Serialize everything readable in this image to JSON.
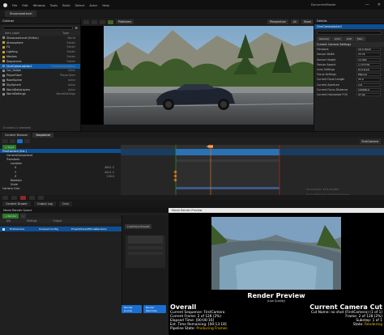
{
  "menu": [
    "File",
    "Edit",
    "Window",
    "Tools",
    "Build",
    "Select",
    "Actor",
    "Help"
  ],
  "doc_tab": "ShowcaseLevel",
  "user": "DocumentMaster",
  "outliner": {
    "title": "Outliner",
    "col_label": "Item Label",
    "col_type": "Type",
    "rows": [
      {
        "label": "ShowcaseLevel (Editor)",
        "type": "World",
        "sel": false
      },
      {
        "label": "Atmosphere",
        "type": "Folder",
        "sel": false
      },
      {
        "label": "FX",
        "type": "Folder",
        "sel": false
      },
      {
        "label": "Lighting",
        "type": "Folder",
        "sel": false
      },
      {
        "label": "Meshes",
        "type": "Folder",
        "sel": false
      },
      {
        "label": "Sequences",
        "type": "Folder",
        "sel": false
      },
      {
        "label": "CineCameraActor1",
        "type": "CineCameraActor",
        "sel": true
      },
      {
        "label": "Car_Sedan",
        "type": "Actor",
        "sel": false
      },
      {
        "label": "PlayerStart",
        "type": "PlayerStart",
        "sel": false
      },
      {
        "label": "RoadSpline",
        "type": "Actor",
        "sel": false
      },
      {
        "label": "SkySphere",
        "type": "Actor",
        "sel": false
      },
      {
        "label": "WorldDataLayers",
        "type": "Actor",
        "sel": false
      },
      {
        "label": "WorldSettings",
        "type": "WorldSettings",
        "sel": false
      }
    ],
    "footer": "13 actors (1 selected)"
  },
  "viewport": {
    "mode": "Perspective",
    "lit": "Lit",
    "show": "Show",
    "platforms": "Platforms"
  },
  "details": {
    "title": "Details",
    "selected": "CineCameraActor1",
    "tabs": [
      "General",
      "Actor",
      "LOD",
      "Misc"
    ],
    "category": "Current Camera Settings",
    "rows": [
      {
        "label": "Filmback",
        "value": "16:9 DSLR"
      },
      {
        "label": "Sensor Width",
        "value": "23.76"
      },
      {
        "label": "Sensor Height",
        "value": "13.365"
      },
      {
        "label": "Sensor Aspect",
        "value": "1.777778"
      },
      {
        "label": "Lens Settings",
        "value": "Universal"
      },
      {
        "label": "Focus Settings",
        "value": "Manual"
      },
      {
        "label": "Current Focal Length",
        "value": "35.0"
      },
      {
        "label": "Current Aperture",
        "value": "2.8"
      },
      {
        "label": "Current Focus Distance",
        "value": "100000.0"
      },
      {
        "label": "Current Horizontal FOV",
        "value": "37.49"
      }
    ]
  },
  "sequencer": {
    "tabs": [
      "Content Browser",
      "Sequencer"
    ],
    "track_btn": "+ Track",
    "sequence": "FirstCamera",
    "tracks": [
      {
        "label": "FirstCamera (Ext.)",
        "indent": 0,
        "sel": true,
        "v": ""
      },
      {
        "label": "CameraComponent",
        "indent": 1,
        "sel": false,
        "v": ""
      },
      {
        "label": "Transform",
        "indent": 1,
        "sel": false,
        "v": ""
      },
      {
        "label": "Location",
        "indent": 2,
        "sel": false,
        "v": ""
      },
      {
        "label": "X",
        "indent": 3,
        "sel": false,
        "v": "-8851.5"
      },
      {
        "label": "Y",
        "indent": 3,
        "sel": false,
        "v": "-6421.2"
      },
      {
        "label": "Z",
        "indent": 3,
        "sel": false,
        "v": "250.0"
      },
      {
        "label": "Rotation",
        "indent": 2,
        "sel": false,
        "v": ""
      },
      {
        "label": "Scale",
        "indent": 2,
        "sel": false,
        "v": ""
      },
      {
        "label": "Camera Cuts",
        "indent": 0,
        "sel": false,
        "v": ""
      }
    ],
    "frame": "0029",
    "foot_items": [
      "Content Drawer",
      "Output Log",
      "Cmd"
    ],
    "watermark": "Activate Windows",
    "watermark2": "Go to Settings to activate Windows."
  },
  "bottom_tabs": [
    "Content Drawer",
    "Output Log",
    "Cmd"
  ],
  "mrq": {
    "title": "Movie Render Queue",
    "buttons": [
      "+ Render",
      "- ",
      "Load/Save Presets"
    ],
    "cols": [
      "Job",
      "Settings",
      "Output"
    ],
    "job": {
      "name": "FirstCamera",
      "settings": "Unsaved Config",
      "output": "Project/Saved/MovieRenders/"
    },
    "settings_title": "Load/Save Presets",
    "render_local": "Render (Local)",
    "render_remote": "Render (Remote)"
  },
  "render": {
    "title": "Movie Render Preview",
    "heading": "Render Preview",
    "sub": "(Low Quality)",
    "overall_head": "Overall",
    "overall": [
      {
        "k": "Current Sequence:",
        "v": "FirstCamera"
      },
      {
        "k": "Current Frame:",
        "v": "2 of 128 (2%)"
      },
      {
        "k": "Elapsed Time:",
        "v": "[00:00:16]"
      },
      {
        "k": "Est. Time Remaining:",
        "v": "[00:13:18]"
      },
      {
        "k": "Pipeline State:",
        "v": "Producing Frames"
      }
    ],
    "cut_head": "Current Camera Cut",
    "cut": [
      {
        "k": "Cut Name:",
        "v": "no shot (FirstCamera) (1 of 1)"
      },
      {
        "k": "Frame:",
        "v": "2 of 128 (2%)"
      },
      {
        "k": "Substep:",
        "v": "1 of 1"
      },
      {
        "k": "State:",
        "v": "Rendering"
      }
    ]
  }
}
